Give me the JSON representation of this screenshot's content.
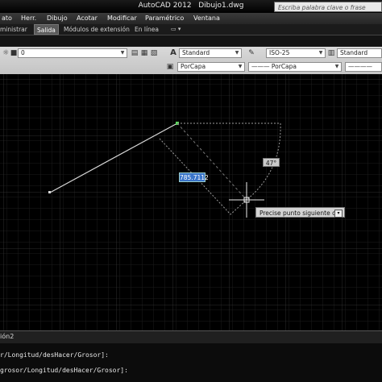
{
  "window": {
    "app_name": "AutoCAD 2012",
    "document": "Dibujo1.dwg",
    "search_placeholder": "Escriba palabra clave o frase"
  },
  "menu": [
    "ato",
    "Herr.",
    "Dibujo",
    "Acotar",
    "Modificar",
    "Paramétrico",
    "Ventana"
  ],
  "ribbon_tabs": [
    "ministrar",
    "Salida",
    "Módulos de extensión",
    "En línea"
  ],
  "toolbar": {
    "layer_value": "0",
    "text_style": "Standard",
    "dim_style": "ISO-25",
    "table_style": "Standard",
    "color_value": "PorCapa",
    "linetype_value": "PorCapa"
  },
  "drawing": {
    "dim_value": "785.7112",
    "angle_value": "47°",
    "prompt": "Precise punto siguiente o"
  },
  "layout_tab": "ión2",
  "command_lines": [
    "r/Longitud/desHacer/Grosor]:",
    "grosor/Longitud/desHacer/Grosor]:"
  ],
  "colors": {
    "canvas_bg": "#000000",
    "grid_line": "#1d1d1d",
    "grid_major": "#2c2c2c",
    "dim_highlight": "#3a74c8",
    "polyline": "#d8d8d8"
  }
}
